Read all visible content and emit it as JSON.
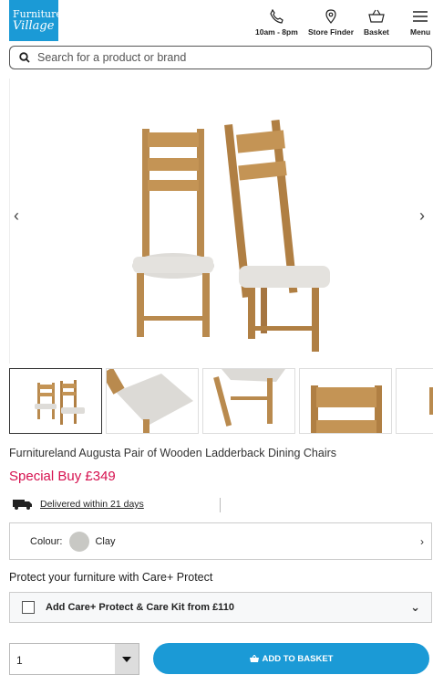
{
  "header": {
    "logo_line1": "Furniture",
    "logo_line2": "Village",
    "hours_label": "10am - 8pm",
    "store_finder_label": "Store Finder",
    "basket_label": "Basket",
    "menu_label": "Menu",
    "brand_color": "#1b9ad6"
  },
  "search": {
    "placeholder": "Search for a product or brand"
  },
  "product": {
    "title": "Furnitureland Augusta Pair of Wooden Ladderback Dining Chairs",
    "price": "Special Buy £349",
    "price_color": "#d6114f",
    "delivery": "Delivered within 21 days",
    "colour_label": "Colour:",
    "colour_value": "Clay",
    "swatch_color": "#c8c8c4"
  },
  "protect": {
    "title": "Protect your furniture with Care+ Protect",
    "option_label": "Add Care+ Protect & Care Kit from £110"
  },
  "purchase": {
    "quantity": "1",
    "add_button_label": "ADD TO BASKET"
  }
}
